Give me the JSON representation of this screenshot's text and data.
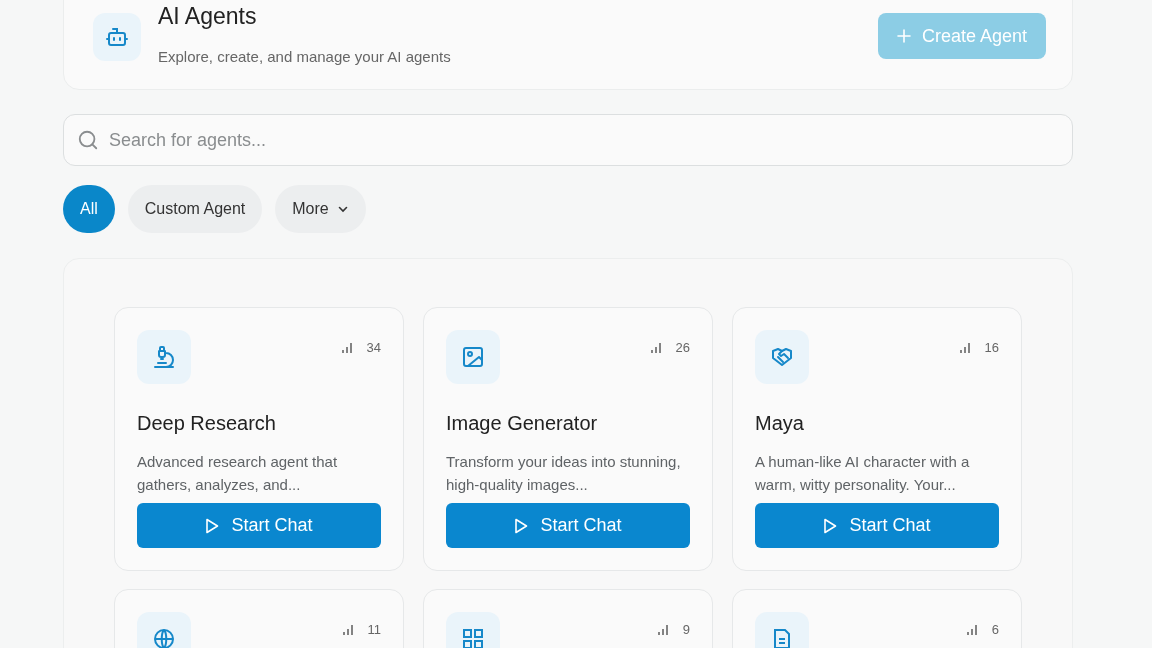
{
  "header": {
    "title": "AI Agents",
    "subtitle": "Explore, create, and manage your AI agents",
    "create_button": {
      "label": "Create Agent",
      "disabled": true
    }
  },
  "search": {
    "placeholder": "Search for agents..."
  },
  "filters": [
    {
      "label": "All",
      "selected": true,
      "kind": "chip"
    },
    {
      "label": "Custom Agent",
      "selected": false,
      "kind": "chip"
    },
    {
      "label": "More",
      "selected": false,
      "kind": "dropdown"
    }
  ],
  "agents": [
    {
      "count": "34",
      "name": "Deep Research",
      "description": "Advanced research agent that gathers, analyzes, and...",
      "action": "Start Chat"
    },
    {
      "count": "26",
      "name": "Image Generator",
      "description": "Transform your ideas into stunning, high-quality images...",
      "action": "Start Chat"
    },
    {
      "count": "16",
      "name": "Maya",
      "description": "A human-like AI character with a warm, witty personality. Your...",
      "action": "Start Chat"
    },
    {
      "count": "11"
    },
    {
      "count": "9"
    },
    {
      "count": "6"
    }
  ]
}
